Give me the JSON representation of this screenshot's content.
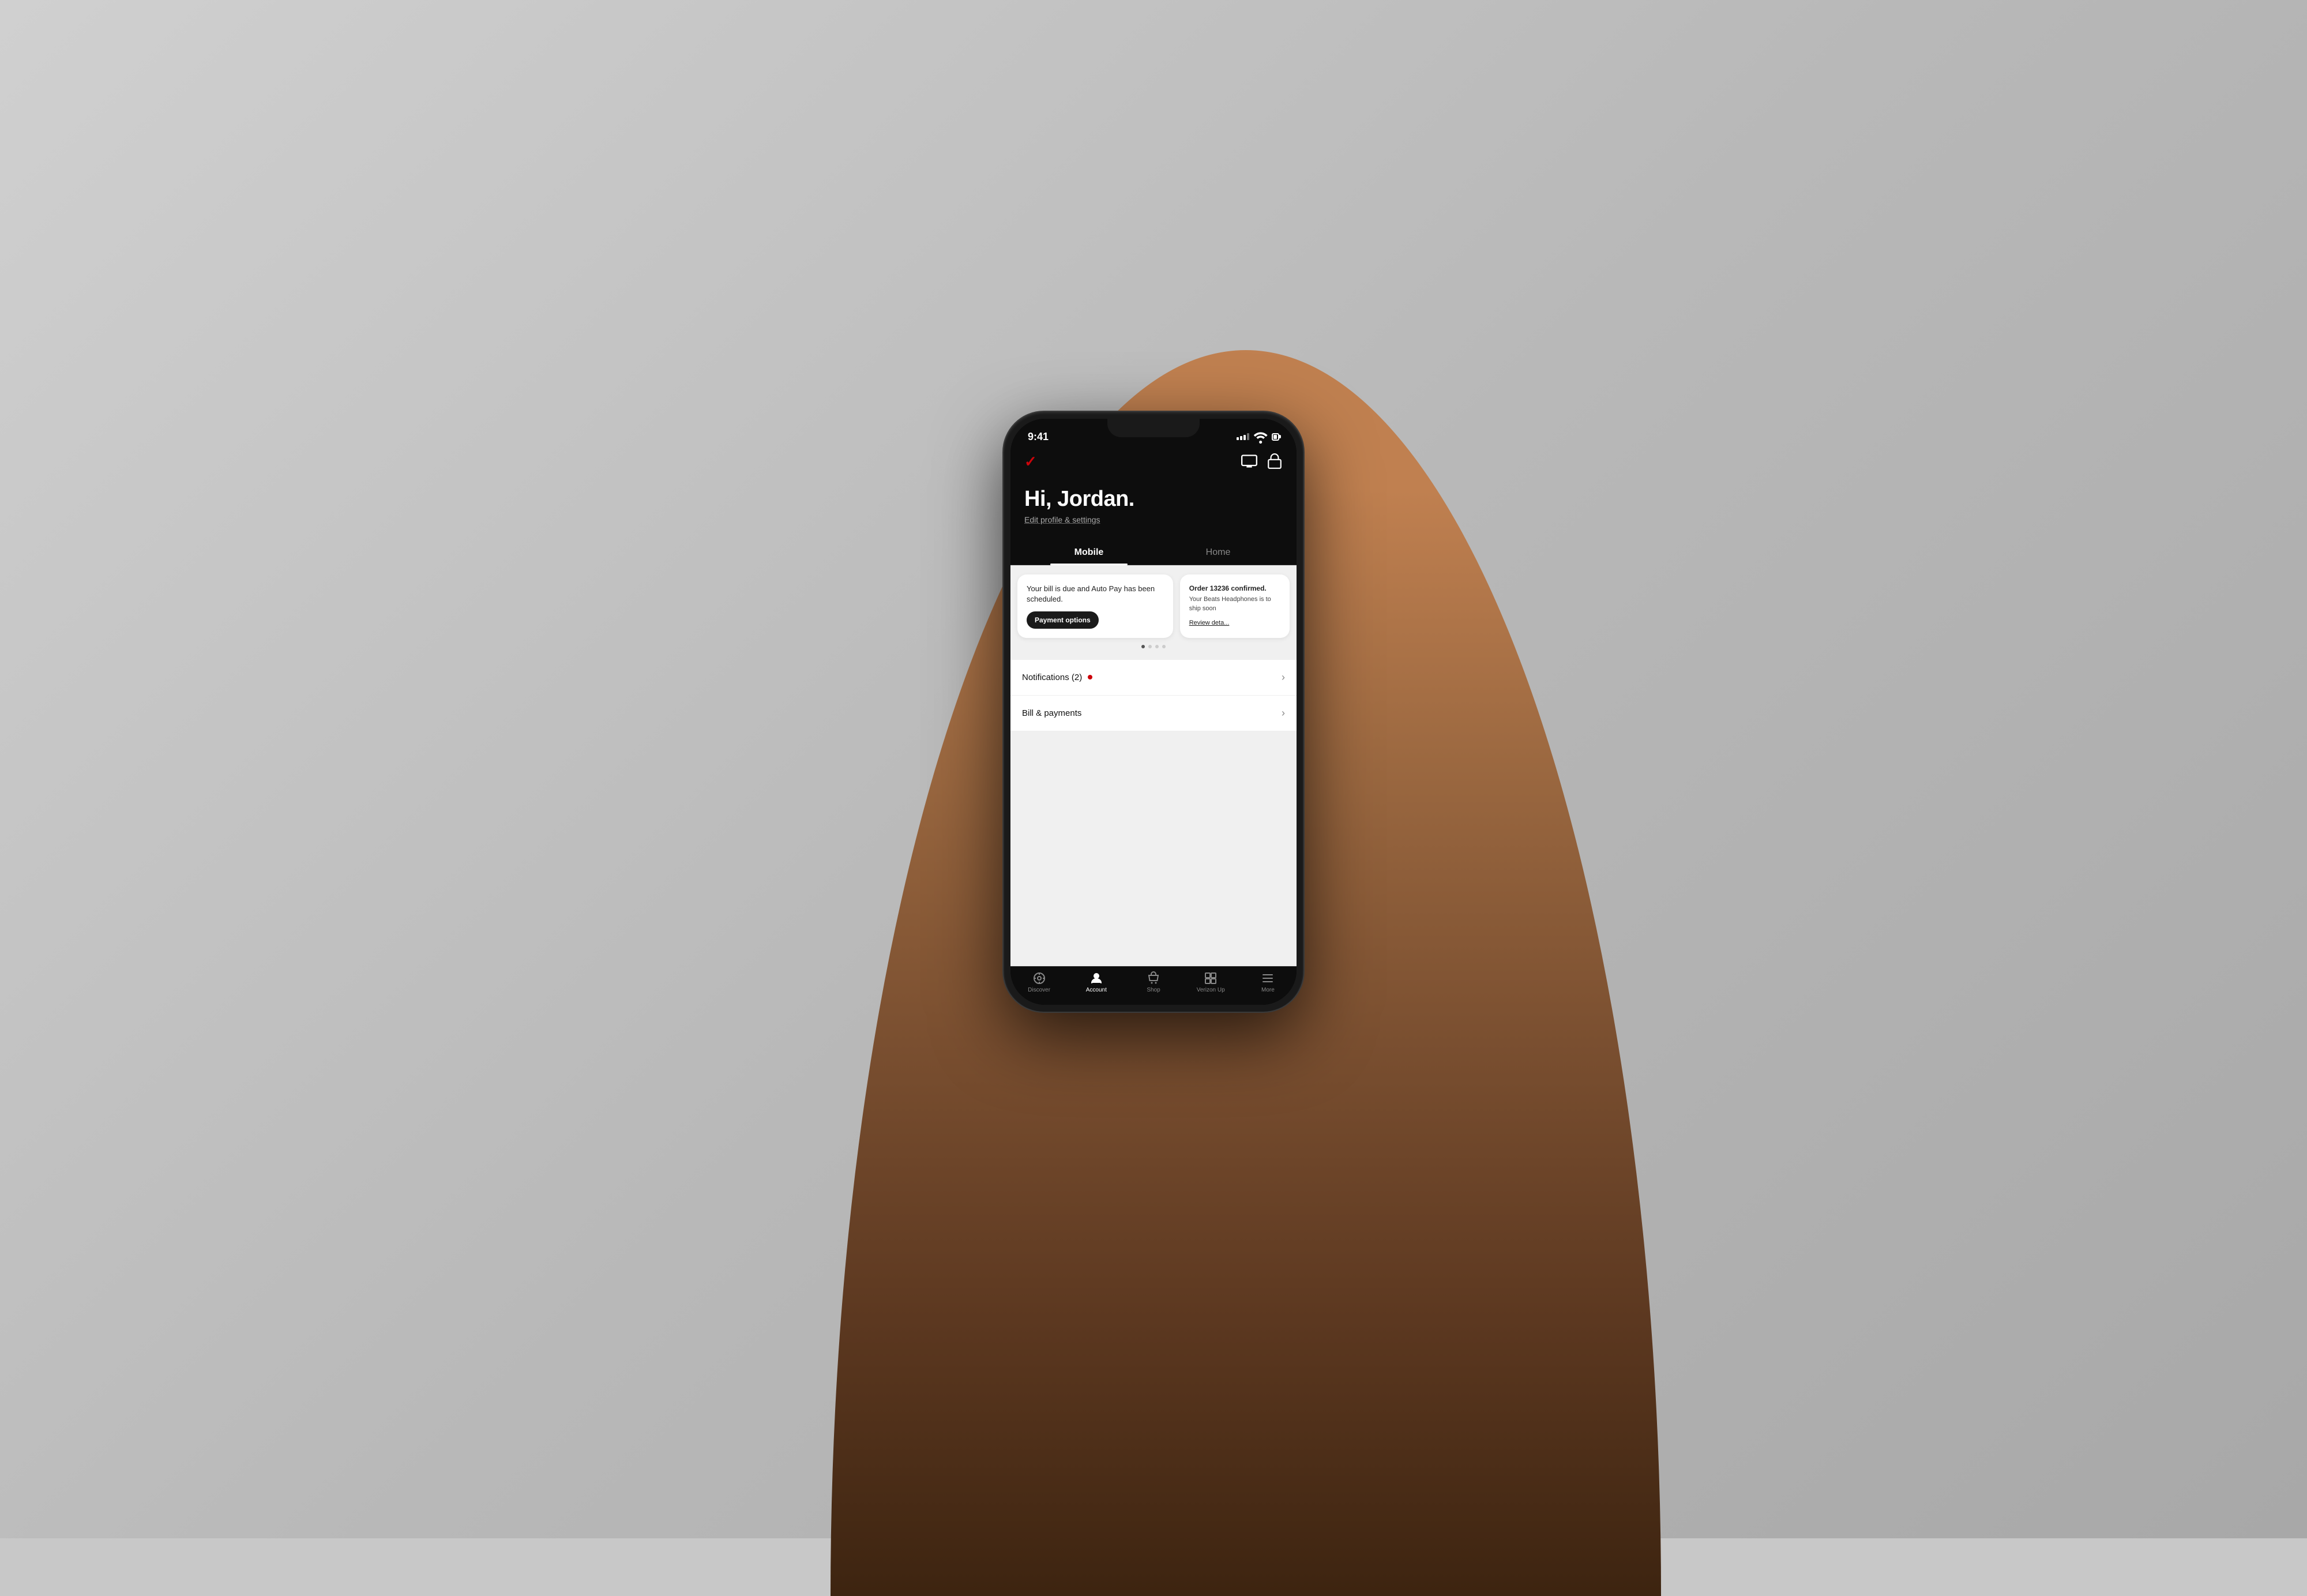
{
  "background": {
    "color": "#c8c8c8"
  },
  "status_bar": {
    "time": "9:41",
    "signal_label": "signal",
    "wifi_label": "wifi",
    "battery_label": "battery"
  },
  "header": {
    "logo": "✓",
    "tv_icon": "tv",
    "bag_icon": "shopping-bag"
  },
  "greeting": {
    "text": "Hi, Jordan.",
    "edit_link": "Edit profile & settings"
  },
  "tabs": [
    {
      "label": "Mobile",
      "active": true
    },
    {
      "label": "Home",
      "active": false
    }
  ],
  "cards": [
    {
      "id": "payment-card",
      "body": "Your bill is due and Auto Pay has been scheduled.",
      "button": "Payment options"
    },
    {
      "id": "order-card",
      "title": "Order 13236 confirmed.",
      "body": "Your Beats Headphones is to ship soon",
      "link": "Review deta..."
    }
  ],
  "carousel_dots": [
    true,
    false,
    false,
    false
  ],
  "list_items": [
    {
      "label": "Notifications (2)",
      "has_badge": true,
      "arrow": "›"
    },
    {
      "label": "Bill & payments",
      "has_badge": false,
      "arrow": "›"
    }
  ],
  "bottom_nav": [
    {
      "id": "discover",
      "label": "Discover",
      "active": false
    },
    {
      "id": "account",
      "label": "Account",
      "active": true
    },
    {
      "id": "shop",
      "label": "Shop",
      "active": false
    },
    {
      "id": "verizon-up",
      "label": "Verizon Up",
      "active": false
    },
    {
      "id": "more",
      "label": "More",
      "active": false
    }
  ]
}
